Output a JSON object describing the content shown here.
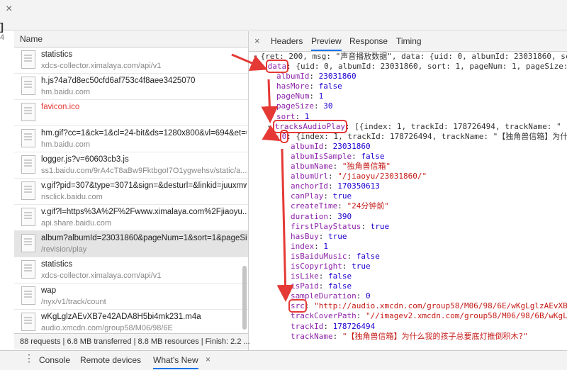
{
  "window": {
    "close_icon": "×",
    "edge_text": "]",
    "edge_text2": "4"
  },
  "request_list": {
    "header": "Name",
    "rows": [
      {
        "name": "statistics",
        "sub": "xdcs-collector.ximalaya.com/api/v1",
        "error": false,
        "selected": false
      },
      {
        "name": "h.js?4a7d8ec50cfd6af753c4f8aee3425070",
        "sub": "hm.baidu.com",
        "error": false,
        "selected": false
      },
      {
        "name": "favicon.ico",
        "sub": "",
        "error": true,
        "selected": false
      },
      {
        "name": "hm.gif?cc=1&ck=1&cl=24-bit&ds=1280x800&vl=694&et=0...",
        "sub": "hm.baidu.com",
        "error": false,
        "selected": false
      },
      {
        "name": "logger.js?v=60603cb3.js",
        "sub": "ss1.baidu.com/9rA4cT8aBw9FktbgoI7O1ygwehsv/static/a...",
        "error": false,
        "selected": false
      },
      {
        "name": "v.gif?pid=307&type=3071&sign=&desturl=&linkid=juuxmw...",
        "sub": "nsclick.baidu.com",
        "error": false,
        "selected": false
      },
      {
        "name": "v.gif?l=https%3A%2F%2Fwww.ximalaya.com%2Fjiaoyu...",
        "sub": "api.share.baidu.com",
        "error": false,
        "selected": false
      },
      {
        "name": "album?albumId=23031860&pageNum=1&sort=1&pageSiz...",
        "sub": "/revision/play",
        "error": false,
        "selected": true
      },
      {
        "name": "statistics",
        "sub": "xdcs-collector.ximalaya.com/api/v1",
        "error": false,
        "selected": false
      },
      {
        "name": "wap",
        "sub": "/nyx/v1/track/count",
        "error": false,
        "selected": false
      },
      {
        "name": "wKgLglzAEvXB7e42ADA8H5bi4mk231.m4a",
        "sub": "audio.xmcdn.com/group58/M06/98/6E",
        "error": false,
        "selected": false
      }
    ],
    "footer": "88 requests | 6.8 MB transferred | 8.8 MB resources | Finish: 2.2 ..."
  },
  "detail": {
    "close_icon": "×",
    "tabs": [
      "Headers",
      "Preview",
      "Response",
      "Timing"
    ],
    "active_tab": "Preview",
    "lines": [
      {
        "indent": 0,
        "arrow": "▼",
        "parts": [
          [
            "t",
            "{ret: 200, msg: \"声音播放数据\", data: {uid: 0, albumId: 23031860, sc"
          ]
        ]
      },
      {
        "indent": 1,
        "arrow": "▼",
        "hl": "data",
        "parts": [
          [
            "k",
            "data"
          ],
          [
            "t",
            ": {uid: 0, albumId: 23031860, sort: 1, pageNum: 1, pageSize: "
          ]
        ]
      },
      {
        "indent": 2,
        "parts": [
          [
            "k",
            "albumId"
          ],
          [
            "t",
            ": "
          ],
          [
            "n",
            "23031860"
          ]
        ]
      },
      {
        "indent": 2,
        "parts": [
          [
            "k",
            "hasMore"
          ],
          [
            "t",
            ": "
          ],
          [
            "n",
            "false"
          ]
        ]
      },
      {
        "indent": 2,
        "parts": [
          [
            "k",
            "pageNum"
          ],
          [
            "t",
            ": "
          ],
          [
            "n",
            "1"
          ]
        ]
      },
      {
        "indent": 2,
        "parts": [
          [
            "k",
            "pageSize"
          ],
          [
            "t",
            ": "
          ],
          [
            "n",
            "30"
          ]
        ]
      },
      {
        "indent": 2,
        "parts": [
          [
            "k",
            "sort"
          ],
          [
            "t",
            ": "
          ],
          [
            "n",
            "1"
          ]
        ]
      },
      {
        "indent": 2,
        "arrow": "▼",
        "hl": "tracksAudioPlay",
        "parts": [
          [
            "k",
            "tracksAudioPlay"
          ],
          [
            "t",
            ": [{index: 1, trackId: 178726494, trackName: \" |"
          ]
        ]
      },
      {
        "indent": 3,
        "arrow": "▼",
        "hl": "0",
        "parts": [
          [
            "k",
            "0"
          ],
          [
            "t",
            ": {index: 1, trackId: 178726494, trackName: \"【独角兽信箱】为什"
          ]
        ]
      },
      {
        "indent": 4,
        "parts": [
          [
            "k",
            "albumId"
          ],
          [
            "t",
            ": "
          ],
          [
            "n",
            "23031860"
          ]
        ]
      },
      {
        "indent": 4,
        "parts": [
          [
            "k",
            "albumIsSample"
          ],
          [
            "t",
            ": "
          ],
          [
            "n",
            "false"
          ]
        ]
      },
      {
        "indent": 4,
        "parts": [
          [
            "k",
            "albumName"
          ],
          [
            "t",
            ": "
          ],
          [
            "s",
            "\"独角兽信箱\""
          ]
        ]
      },
      {
        "indent": 4,
        "parts": [
          [
            "k",
            "albumUrl"
          ],
          [
            "t",
            ": "
          ],
          [
            "s",
            "\"/jiaoyu/23031860/\""
          ]
        ]
      },
      {
        "indent": 4,
        "parts": [
          [
            "k",
            "anchorId"
          ],
          [
            "t",
            ": "
          ],
          [
            "n",
            "170350613"
          ]
        ]
      },
      {
        "indent": 4,
        "parts": [
          [
            "k",
            "canPlay"
          ],
          [
            "t",
            ": "
          ],
          [
            "n",
            "true"
          ]
        ]
      },
      {
        "indent": 4,
        "parts": [
          [
            "k",
            "createTime"
          ],
          [
            "t",
            ": "
          ],
          [
            "s",
            "\"24分钟前\""
          ]
        ]
      },
      {
        "indent": 4,
        "parts": [
          [
            "k",
            "duration"
          ],
          [
            "t",
            ": "
          ],
          [
            "n",
            "390"
          ]
        ]
      },
      {
        "indent": 4,
        "parts": [
          [
            "k",
            "firstPlayStatus"
          ],
          [
            "t",
            ": "
          ],
          [
            "n",
            "true"
          ]
        ]
      },
      {
        "indent": 4,
        "parts": [
          [
            "k",
            "hasBuy"
          ],
          [
            "t",
            ": "
          ],
          [
            "n",
            "true"
          ]
        ]
      },
      {
        "indent": 4,
        "parts": [
          [
            "k",
            "index"
          ],
          [
            "t",
            ": "
          ],
          [
            "n",
            "1"
          ]
        ]
      },
      {
        "indent": 4,
        "parts": [
          [
            "k",
            "isBaiduMusic"
          ],
          [
            "t",
            ": "
          ],
          [
            "n",
            "false"
          ]
        ]
      },
      {
        "indent": 4,
        "parts": [
          [
            "k",
            "isCopyright"
          ],
          [
            "t",
            ": "
          ],
          [
            "n",
            "true"
          ]
        ]
      },
      {
        "indent": 4,
        "parts": [
          [
            "k",
            "isLike"
          ],
          [
            "t",
            ": "
          ],
          [
            "n",
            "false"
          ]
        ]
      },
      {
        "indent": 4,
        "parts": [
          [
            "k",
            "isPaid"
          ],
          [
            "t",
            ": "
          ],
          [
            "n",
            "false"
          ]
        ]
      },
      {
        "indent": 4,
        "parts": [
          [
            "k",
            "sampleDuration"
          ],
          [
            "t",
            ": "
          ],
          [
            "n",
            "0"
          ]
        ]
      },
      {
        "indent": 4,
        "hl": "src",
        "parts": [
          [
            "k",
            "src"
          ],
          [
            "t",
            ": "
          ],
          [
            "s",
            "\"http://audio.xmcdn.com/group58/M06/98/6E/wKgLglzAEvXB"
          ]
        ]
      },
      {
        "indent": 4,
        "parts": [
          [
            "k",
            "trackCoverPath"
          ],
          [
            "t",
            ": "
          ],
          [
            "s",
            "\"//imagev2.xmcdn.com/group58/M06/98/6B/wKgL"
          ]
        ]
      },
      {
        "indent": 4,
        "parts": [
          [
            "k",
            "trackId"
          ],
          [
            "t",
            ": "
          ],
          [
            "n",
            "178726494"
          ]
        ]
      },
      {
        "indent": 4,
        "parts": [
          [
            "k",
            "trackName"
          ],
          [
            "t",
            ": "
          ],
          [
            "s",
            "\"【独角兽信箱】为什么我的孩子总要底灯推倒积木?\""
          ]
        ]
      }
    ]
  },
  "drawer": {
    "menu_icon": "⋮",
    "tabs": [
      "Console",
      "Remote devices",
      "What's New"
    ],
    "active_tab": "What's New",
    "close_icon": "×"
  },
  "colors": {
    "annotation": "#e53935",
    "key": "#8e24aa",
    "number": "#1c00cf",
    "string": "#c41a16",
    "accent": "#1a73e8"
  }
}
